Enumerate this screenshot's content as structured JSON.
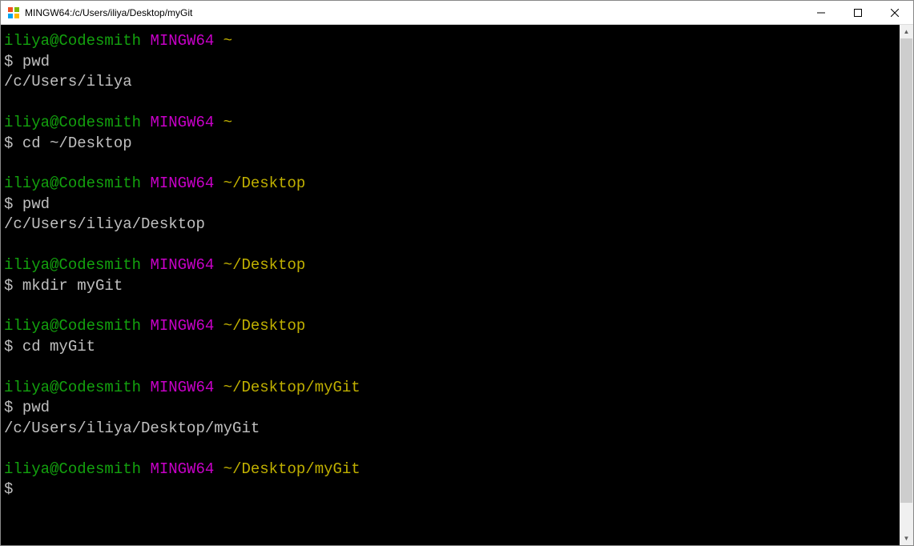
{
  "window": {
    "title": "MINGW64:/c/Users/iliya/Desktop/myGit"
  },
  "terminal": {
    "blocks": [
      {
        "user": "iliya@Codesmith",
        "env": "MINGW64",
        "path": "~",
        "dollar": "$",
        "cmd": "pwd",
        "output": "/c/Users/iliya"
      },
      {
        "user": "iliya@Codesmith",
        "env": "MINGW64",
        "path": "~",
        "dollar": "$",
        "cmd": "cd ~/Desktop",
        "output": ""
      },
      {
        "user": "iliya@Codesmith",
        "env": "MINGW64",
        "path": "~/Desktop",
        "dollar": "$",
        "cmd": "pwd",
        "output": "/c/Users/iliya/Desktop"
      },
      {
        "user": "iliya@Codesmith",
        "env": "MINGW64",
        "path": "~/Desktop",
        "dollar": "$",
        "cmd": "mkdir myGit",
        "output": ""
      },
      {
        "user": "iliya@Codesmith",
        "env": "MINGW64",
        "path": "~/Desktop",
        "dollar": "$",
        "cmd": "cd myGit",
        "output": ""
      },
      {
        "user": "iliya@Codesmith",
        "env": "MINGW64",
        "path": "~/Desktop/myGit",
        "dollar": "$",
        "cmd": "pwd",
        "output": "/c/Users/iliya/Desktop/myGit"
      },
      {
        "user": "iliya@Codesmith",
        "env": "MINGW64",
        "path": "~/Desktop/myGit",
        "dollar": "$",
        "cmd": "",
        "output": ""
      }
    ]
  }
}
